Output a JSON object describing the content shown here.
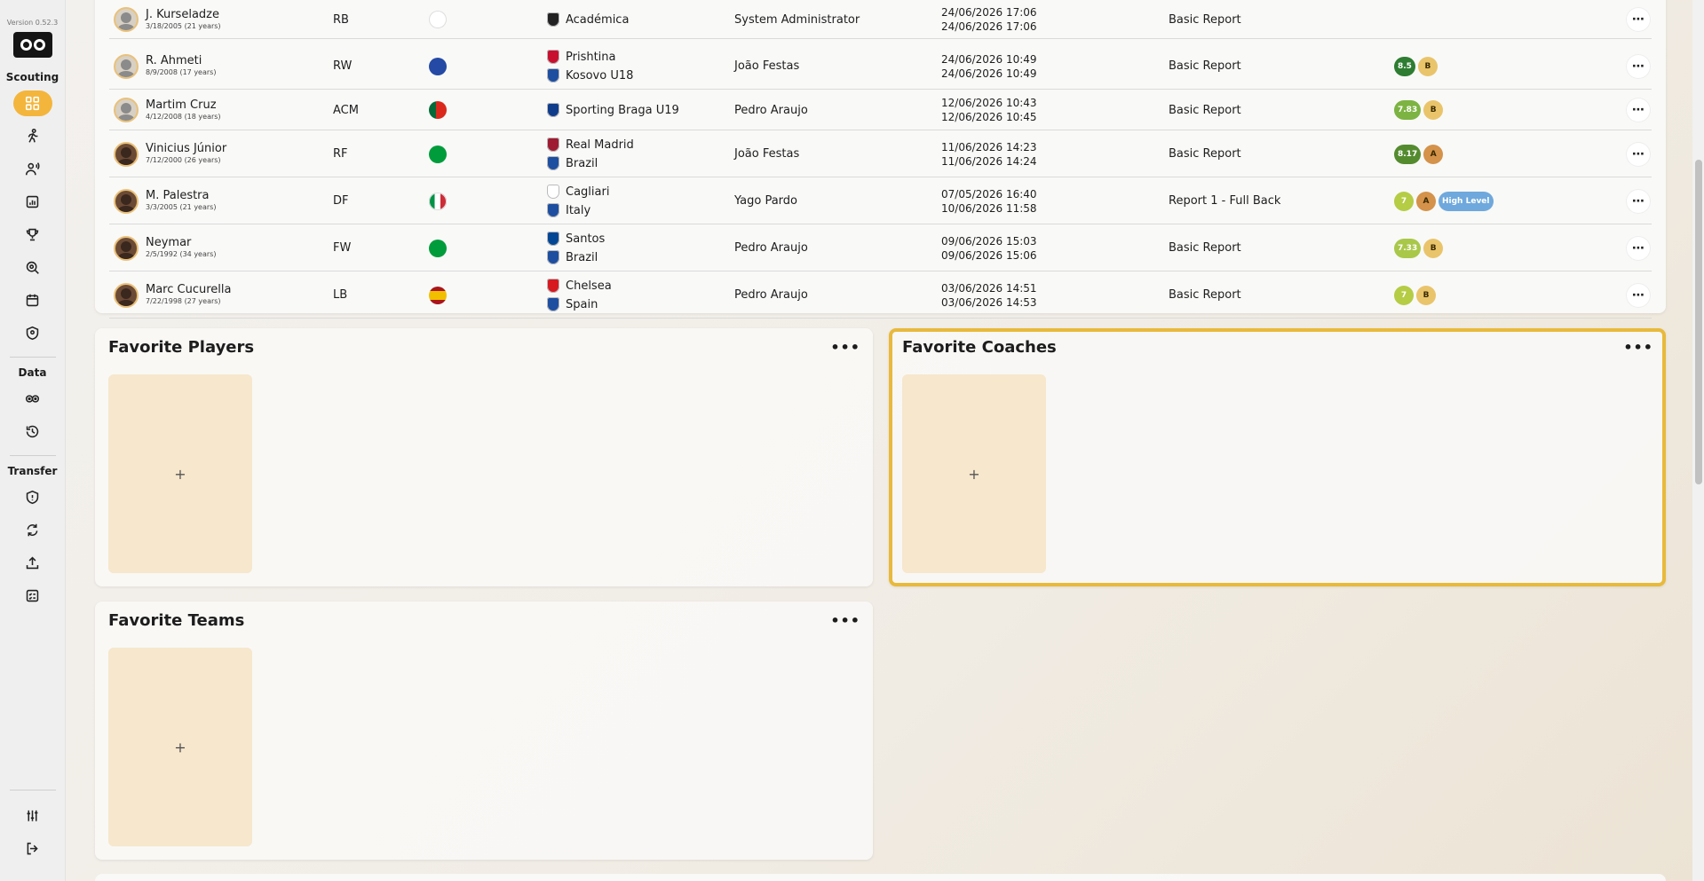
{
  "sidebar": {
    "version": "Version 0.52.3",
    "sections": {
      "scouting": "Scouting",
      "data": "Data",
      "transfer": "Transfer"
    },
    "icons": [
      "dashboard-icon",
      "player-run-icon",
      "scout-icon",
      "reports-icon",
      "trophy-icon",
      "target-icon",
      "calendar-icon",
      "shield-icon",
      "data-icon",
      "history-icon",
      "transfer-shield-icon",
      "exchange-icon",
      "upload-icon",
      "checklist-icon",
      "settings-icon",
      "logout-icon"
    ]
  },
  "reports": {
    "rows": [
      {
        "name": "J. Kurseladze",
        "dob": "3/18/2005 (21 years)",
        "pos": "RB",
        "flag": "georgia",
        "team1": "Académica",
        "team2": "",
        "scout": "System Administrator",
        "date1": "24/06/2026 17:06",
        "date2": "24/06/2026 17:06",
        "template": "Basic Report",
        "scores": []
      },
      {
        "name": "R. Ahmeti",
        "dob": "8/9/2008 (17 years)",
        "pos": "RW",
        "flag": "kosovo",
        "team1": "Prishtina",
        "team2": "Kosovo U18",
        "scout": "João Festas",
        "date1": "24/06/2026 10:49",
        "date2": "24/06/2026 10:49",
        "template": "Basic Report",
        "scores": [
          {
            "text": "8.5",
            "color": "#2e7d32"
          },
          {
            "text": "B",
            "color": "#e9c46a",
            "grade": true
          }
        ]
      },
      {
        "name": "Martim Cruz",
        "dob": "4/12/2008 (18 years)",
        "pos": "ACM",
        "flag": "portugal",
        "team1": "Sporting Braga U19",
        "team2": "",
        "scout": "Pedro Araujo",
        "date1": "12/06/2026 10:43",
        "date2": "12/06/2026 10:45",
        "template": "Basic Report",
        "scores": [
          {
            "text": "7.83",
            "color": "#7cb342"
          },
          {
            "text": "B",
            "color": "#e9c46a",
            "grade": true
          }
        ]
      },
      {
        "name": "Vinicius Júnior",
        "dob": "7/12/2000 (26 years)",
        "pos": "RF",
        "flag": "brazil",
        "team1": "Real Madrid",
        "team2": "Brazil",
        "scout": "João Festas",
        "date1": "11/06/2026 14:23",
        "date2": "11/06/2026 14:24",
        "template": "Basic Report",
        "scores": [
          {
            "text": "8.17",
            "color": "#558b2f"
          },
          {
            "text": "A",
            "color": "#d4924a",
            "grade": true
          }
        ]
      },
      {
        "name": "M. Palestra",
        "dob": "3/3/2005 (21 years)",
        "pos": "DF",
        "flag": "italy",
        "team1": "Cagliari",
        "team2": "Italy",
        "scout": "Yago Pardo",
        "date1": "07/05/2026 16:40",
        "date2": "10/06/2026 11:58",
        "template": "Report 1 - Full Back",
        "scores": [
          {
            "text": "7",
            "color": "#b5cc45"
          },
          {
            "text": "A",
            "color": "#d4924a",
            "grade": true
          },
          {
            "text": "High Level",
            "color": "#6fa8dc"
          }
        ]
      },
      {
        "name": "Neymar",
        "dob": "2/5/1992 (34 years)",
        "pos": "FW",
        "flag": "brazil",
        "team1": "Santos",
        "team2": "Brazil",
        "scout": "Pedro Araujo",
        "date1": "09/06/2026 15:03",
        "date2": "09/06/2026 15:06",
        "template": "Basic Report",
        "scores": [
          {
            "text": "7.33",
            "color": "#a9c84a"
          },
          {
            "text": "B",
            "color": "#e9c46a",
            "grade": true
          }
        ]
      },
      {
        "name": "Marc Cucurella",
        "dob": "7/22/1998 (27 years)",
        "pos": "LB",
        "flag": "spain",
        "team1": "Chelsea",
        "team2": "Spain",
        "scout": "Pedro Araujo",
        "date1": "03/06/2026 14:51",
        "date2": "03/06/2026 14:53",
        "template": "Basic Report",
        "scores": [
          {
            "text": "7",
            "color": "#b5cc45"
          },
          {
            "text": "B",
            "color": "#e9c46a",
            "grade": true
          }
        ]
      }
    ]
  },
  "favorites": {
    "players_title": "Favorite Players",
    "coaches_title": "Favorite Coaches",
    "teams_title": "Favorite Teams",
    "add_symbol": "+",
    "more_symbol": "•••"
  },
  "colors": {
    "accent": "#f3b53b",
    "highlight_border": "#e8b93b",
    "tile": "#f6e7cd"
  }
}
